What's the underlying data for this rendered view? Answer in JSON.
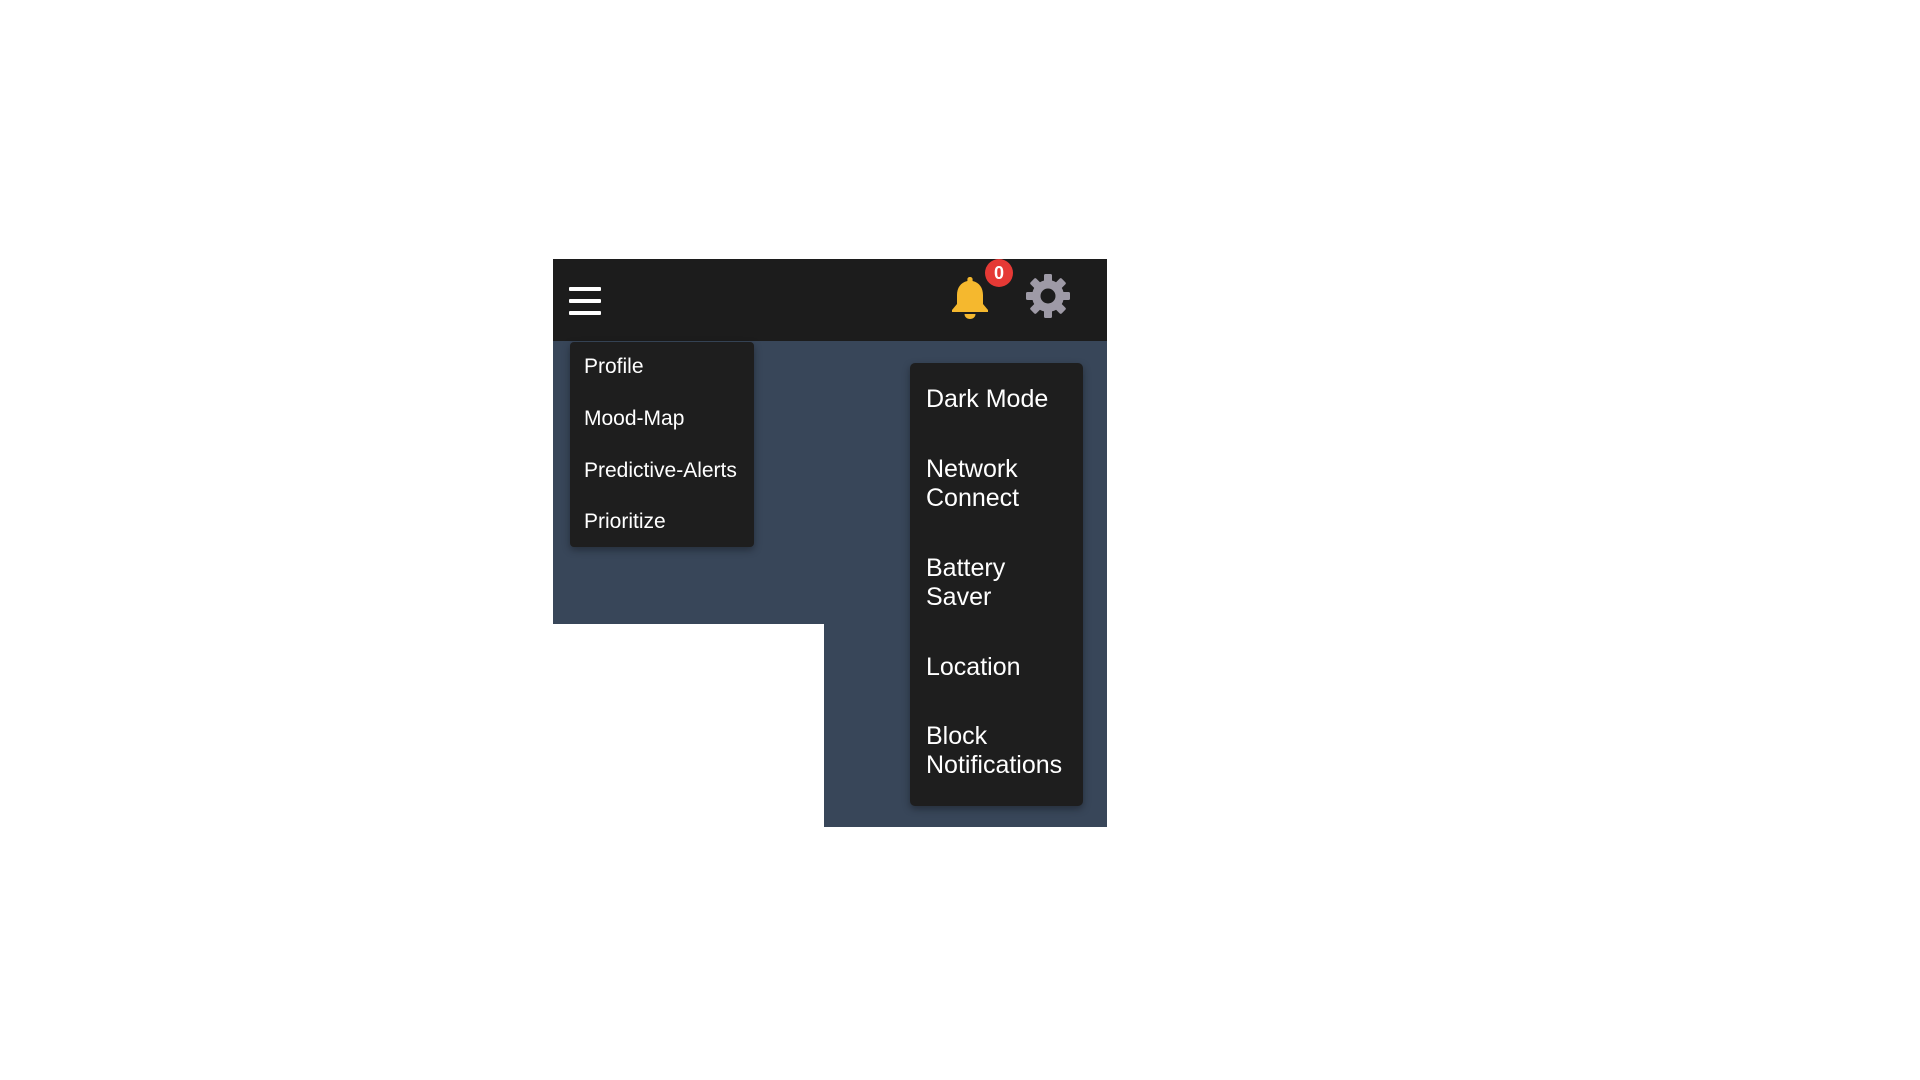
{
  "header": {
    "menu_icon": "hamburger-menu-icon",
    "notifications": {
      "icon": "bell-icon",
      "count": "0",
      "icon_color": "#f5b82e",
      "badge_color": "#e53935"
    },
    "settings_icon": "gear-icon"
  },
  "nav_menu": {
    "items": [
      {
        "label": "Profile"
      },
      {
        "label": "Mood-Map"
      },
      {
        "label": "Predictive-Alerts"
      },
      {
        "label": "Prioritize"
      }
    ]
  },
  "settings_menu": {
    "items": [
      {
        "label": "Dark Mode"
      },
      {
        "label": "Network Connect"
      },
      {
        "label": "Battery Saver"
      },
      {
        "label": "Location"
      },
      {
        "label": "Block Notifications"
      }
    ]
  },
  "colors": {
    "navbar": "#1c1c1c",
    "content_background": "#384659",
    "menu_background": "#1e1e1e",
    "text": "#ffffff"
  }
}
